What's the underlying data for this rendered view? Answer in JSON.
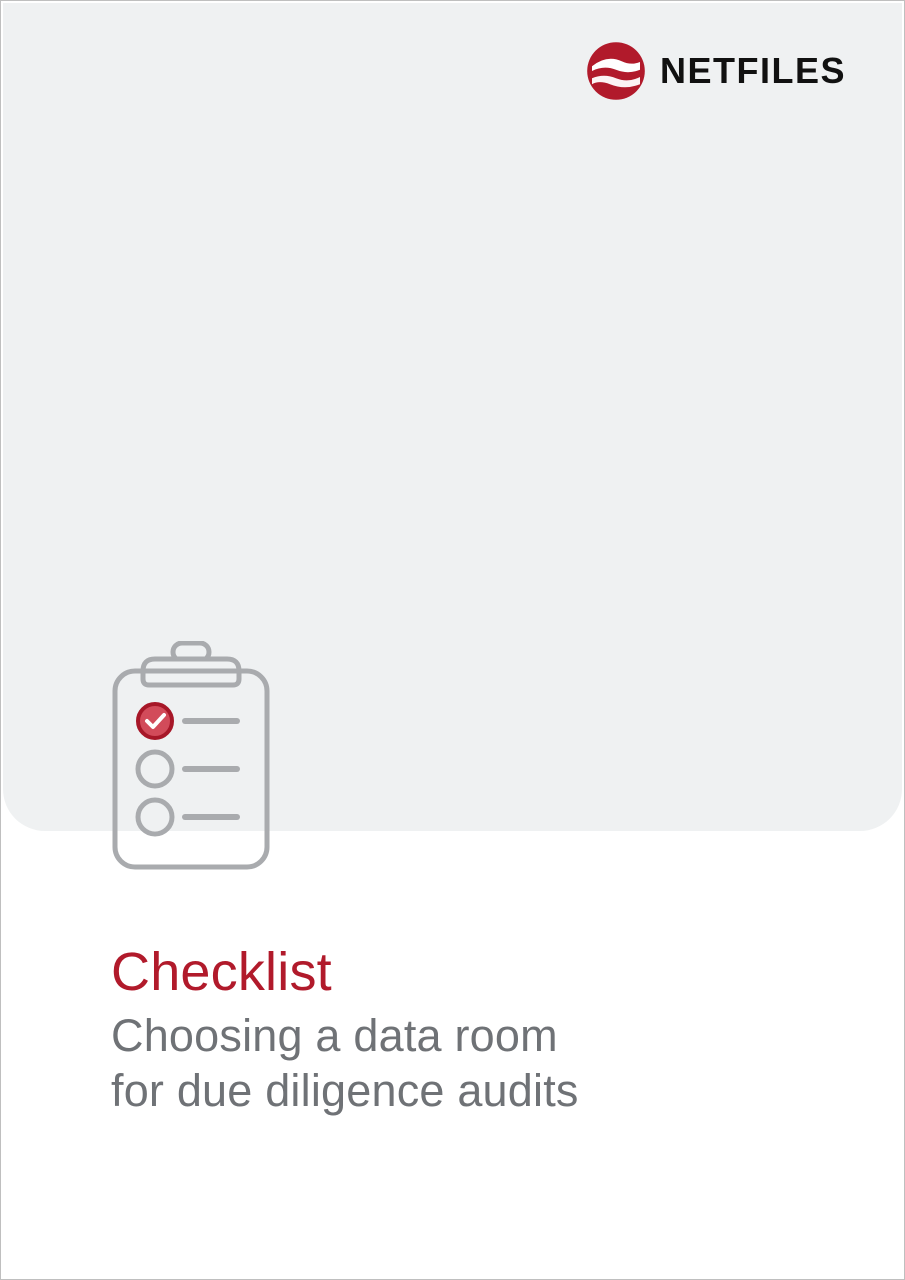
{
  "brand": {
    "name": "NETFILES"
  },
  "cover": {
    "title": "Checklist",
    "subtitle_line1": "Choosing a data room",
    "subtitle_line2": "for due diligence audits"
  }
}
